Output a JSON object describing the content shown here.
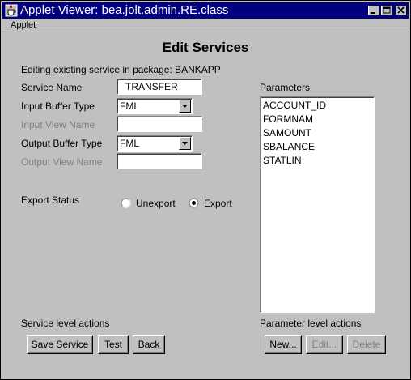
{
  "window": {
    "title": "Applet Viewer: bea.jolt.admin.RE.class"
  },
  "menu": {
    "applet": "Applet"
  },
  "page": {
    "heading": "Edit Services",
    "subtitle": "Editing existing service in package: BANKAPP"
  },
  "form": {
    "service_name_label": "Service Name",
    "service_name_value": "TRANSFER",
    "input_buffer_label": "Input Buffer Type",
    "input_buffer_value": "FML",
    "input_view_label": "Input View Name",
    "input_view_value": "",
    "output_buffer_label": "Output Buffer Type",
    "output_buffer_value": "FML",
    "output_view_label": "Output View Name",
    "output_view_value": "",
    "export_status_label": "Export Status",
    "unexport_label": "Unexport",
    "export_label": "Export",
    "selected_export": "Export"
  },
  "parameters": {
    "label": "Parameters",
    "items": [
      "ACCOUNT_ID",
      "FORMNAM",
      "SAMOUNT",
      "SBALANCE",
      "STATLIN"
    ]
  },
  "service_actions": {
    "label": "Service level actions",
    "save": "Save Service",
    "test": "Test",
    "back": "Back"
  },
  "parameter_actions": {
    "label": "Parameter level actions",
    "new": "New...",
    "edit": "Edit...",
    "delete": "Delete"
  },
  "colors": {
    "titlebar": "#000080",
    "face": "#c0c0c0"
  }
}
